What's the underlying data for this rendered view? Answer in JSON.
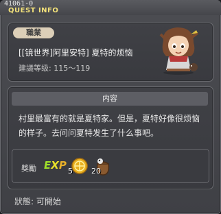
{
  "header": {
    "quest_id": "41061-0",
    "title": "QUEST INFO"
  },
  "quest": {
    "job_tag": "職業",
    "name": "[[镜世界]阿里安特] 夏特的烦恼",
    "level_range": "建議等级: 115～119"
  },
  "content": {
    "header": "内容",
    "description": "村里最富有的就是夏特家。但是，夏特好像很烦恼的样子。去问问夏特发生了什么事吧。"
  },
  "rewards": {
    "label": "獎勵",
    "items": [
      {
        "icon": "exp-icon",
        "text": "EXP"
      },
      {
        "icon": "meso-coin-icon",
        "count": "5"
      },
      {
        "icon": "item-bag-icon",
        "count": "20"
      }
    ]
  },
  "status": {
    "text": "狀態:  可開始"
  },
  "colors": {
    "title_yellow": "#f3e27a",
    "panel_bg": "#404146",
    "job_tag_bg": "#dccfb8"
  }
}
